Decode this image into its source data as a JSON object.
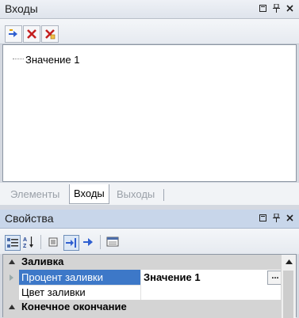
{
  "top_panel": {
    "title": "Входы",
    "tree": {
      "items": [
        {
          "label": "Значение 1"
        }
      ]
    },
    "tabs": [
      {
        "label": "Элементы",
        "active": false
      },
      {
        "label": "Входы",
        "active": true
      },
      {
        "label": "Выходы",
        "active": false
      }
    ]
  },
  "bottom_panel": {
    "title": "Свойства",
    "grid": {
      "categories": [
        {
          "label": "Заливка",
          "properties": [
            {
              "name": "Процент заливки",
              "value": "Значение 1",
              "selected": true,
              "button_label": "..."
            },
            {
              "name": "Цвет заливки",
              "value": "",
              "selected": false
            }
          ]
        },
        {
          "label": "Конечное окончание",
          "properties": []
        }
      ]
    }
  },
  "colors": {
    "selection": "#3d78c8",
    "category_bg": "#d4d4d4",
    "properties_title_bg": "#c8d6ea",
    "delete_red": "#c42020",
    "arrow_blue": "#2f5fd0"
  }
}
